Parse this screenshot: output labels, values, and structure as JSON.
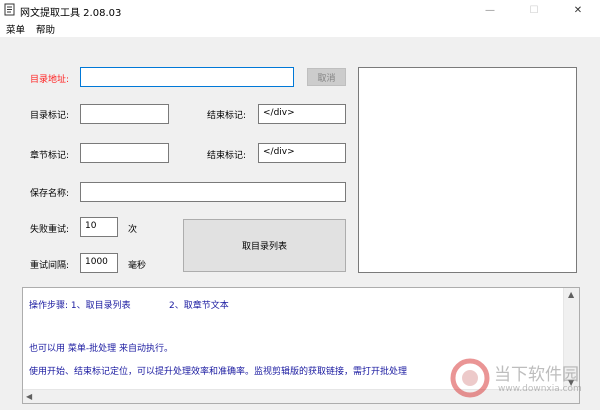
{
  "window": {
    "title": "网文提取工具  2.08.03",
    "controls": {
      "minimize": "—",
      "maximize": "☐",
      "close": "✕"
    }
  },
  "menu": {
    "items": [
      "菜单",
      "帮助"
    ]
  },
  "form": {
    "dir_address_label": "目录地址:",
    "dir_address_value": "",
    "cancel_button": "取消",
    "dir_mark_label": "目录标记:",
    "dir_mark_value": "",
    "dir_end_label": "结束标记:",
    "dir_end_value": "</div>",
    "chapter_mark_label": "章节标记:",
    "chapter_mark_value": "",
    "chapter_end_label": "结束标记:",
    "chapter_end_value": "</div>",
    "save_name_label": "保存名称:",
    "save_name_value": "",
    "retry_label": "失败重试:",
    "retry_value": "10",
    "retry_unit": "次",
    "interval_label": "重试间隔:",
    "interval_value": "1000",
    "interval_unit": "毫秒",
    "get_list_button": "取目录列表"
  },
  "instructions": {
    "line1_a": "操作步骤: 1、取目录列表",
    "line1_b": "2、取章节文本",
    "line2": "也可以用 菜单-批处理 来自动执行。",
    "line3": "使用开始、结束标记定位，可以提升处理效率和准确率。监视剪辑版的获取链接，需打开批处理"
  },
  "watermark": {
    "main": "当下软件园",
    "sub": "www.downxia.com"
  },
  "colors": {
    "label_required": "#ff2020",
    "instructions_text": "#1a1aa0",
    "focus_border": "#0078d7"
  }
}
